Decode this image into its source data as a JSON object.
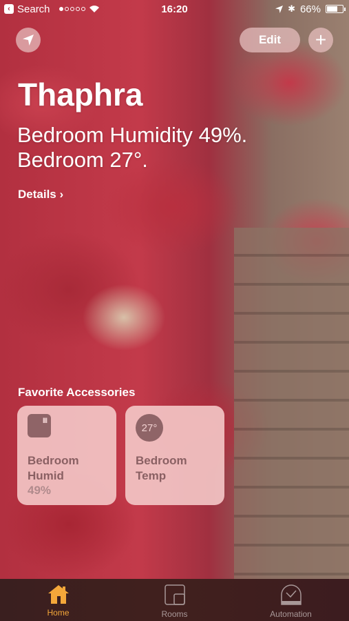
{
  "status_bar": {
    "back_app": "Search",
    "time": "16:20",
    "battery": "66%",
    "battery_level": 0.66,
    "signal_dots_filled": 1,
    "signal_dots_total": 5
  },
  "header": {
    "edit_label": "Edit",
    "add_label": "+",
    "location_icon": "location-arrow-icon"
  },
  "home": {
    "title": "Thaphra",
    "summary_line1": "Bedroom Humidity 49%.",
    "summary_line2": "Bedroom 27°.",
    "details_label": "Details ›"
  },
  "favorites": {
    "section_label": "Favorite Accessories",
    "tiles": [
      {
        "name_line1": "Bedroom",
        "name_line2": "Humid",
        "value": "49%",
        "icon": "humidity-sensor-icon",
        "icon_text": "III"
      },
      {
        "name_line1": "Bedroom",
        "name_line2": "Temp",
        "value": "",
        "icon": "thermometer-icon",
        "icon_text": "27°"
      }
    ]
  },
  "tabbar": {
    "items": [
      {
        "label": "Home",
        "icon": "home-icon",
        "active": true
      },
      {
        "label": "Rooms",
        "icon": "rooms-icon",
        "active": false
      },
      {
        "label": "Automation",
        "icon": "clock-icon",
        "active": false
      }
    ],
    "active_color": "#f4a73a"
  }
}
